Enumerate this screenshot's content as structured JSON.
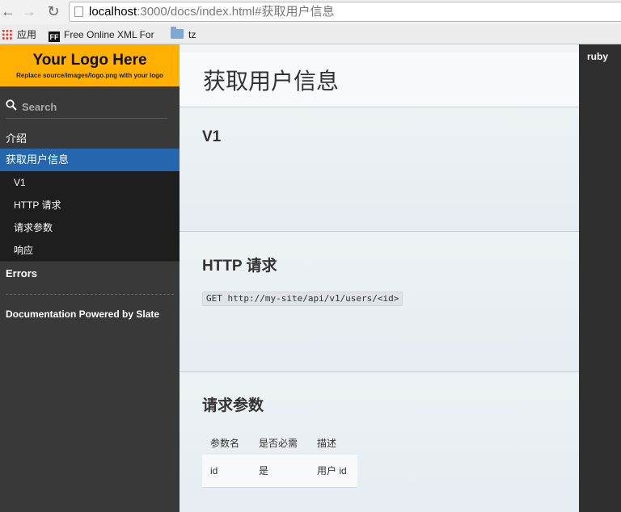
{
  "browser": {
    "url_host": "localhost",
    "url_path": ":3000/docs/index.html#获取用户信息",
    "bookmarks": {
      "apps_label": "应用",
      "xml_label": "Free Online XML For",
      "xml_badge": "FF",
      "folder_label": "tz"
    }
  },
  "sidebar": {
    "logo_title": "Your Logo Here",
    "logo_subtitle": "Replace source/images/logo.png with your logo",
    "search_placeholder": "Search",
    "toc": {
      "intro": "介绍",
      "active": "获取用户信息",
      "sub_items": [
        "V1",
        "HTTP 请求",
        "请求参数",
        "响应"
      ],
      "errors": "Errors",
      "powered_by": "Documentation Powered by Slate"
    },
    "active_color": "#2467af",
    "logo_color": "#ffb000"
  },
  "main": {
    "page_title": "获取用户信息",
    "sections": {
      "v1_title": "V1",
      "http_title": "HTTP 请求",
      "http_code": "GET http://my-site/api/v1/users/<id>",
      "params_title": "请求参数"
    },
    "params_table": {
      "headers": [
        "参数名",
        "是否必需",
        "描述"
      ],
      "rows": [
        [
          "id",
          "是",
          "用户 id"
        ]
      ]
    }
  },
  "code_panel": {
    "language_tab": "ruby"
  }
}
